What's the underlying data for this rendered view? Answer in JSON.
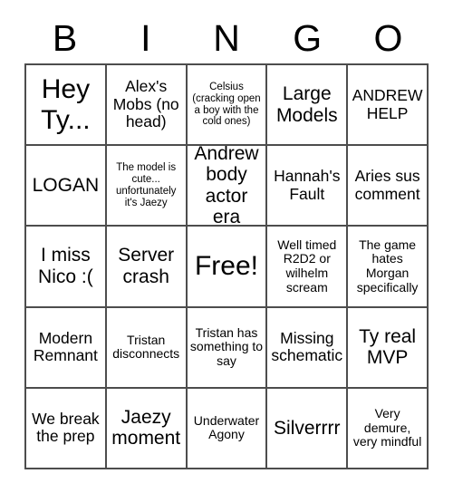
{
  "card": {
    "header_letters": [
      "B",
      "I",
      "N",
      "G",
      "O"
    ],
    "rows": [
      [
        {
          "text": "Hey Ty...",
          "size": "fs-xl"
        },
        {
          "text": "Alex's Mobs (no head)",
          "size": "fs-md"
        },
        {
          "text": "Celsius (cracking open a boy with the cold ones)",
          "size": "fs-xs"
        },
        {
          "text": "Large Models",
          "size": "fs-lg"
        },
        {
          "text": "ANDREW HELP",
          "size": "fs-md"
        }
      ],
      [
        {
          "text": "LOGAN",
          "size": "fs-lg"
        },
        {
          "text": "The model is cute... unfortunately it's Jaezy",
          "size": "fs-xs"
        },
        {
          "text": "Andrew body actor era",
          "size": "fs-lg"
        },
        {
          "text": "Hannah's Fault",
          "size": "fs-md"
        },
        {
          "text": "Aries sus comment",
          "size": "fs-md"
        }
      ],
      [
        {
          "text": "I miss Nico :(",
          "size": "fs-lg"
        },
        {
          "text": "Server crash",
          "size": "fs-lg"
        },
        {
          "text": "Free!",
          "size": "fs-xl"
        },
        {
          "text": "Well timed R2D2 or wilhelm scream",
          "size": "fs-sm"
        },
        {
          "text": "The game hates Morgan specifically",
          "size": "fs-sm"
        }
      ],
      [
        {
          "text": "Modern Remnant",
          "size": "fs-md"
        },
        {
          "text": "Tristan disconnects",
          "size": "fs-sm"
        },
        {
          "text": "Tristan has something to say",
          "size": "fs-sm"
        },
        {
          "text": "Missing schematic",
          "size": "fs-md"
        },
        {
          "text": "Ty real MVP",
          "size": "fs-lg"
        }
      ],
      [
        {
          "text": "We break the prep",
          "size": "fs-md"
        },
        {
          "text": "Jaezy moment",
          "size": "fs-lg"
        },
        {
          "text": "Underwater Agony",
          "size": "fs-sm"
        },
        {
          "text": "Silverrrr",
          "size": "fs-lg"
        },
        {
          "text": "Very demure, very mindful",
          "size": "fs-sm"
        }
      ]
    ]
  },
  "colors": {
    "background": "#ffffff",
    "grid_line": "#4d4d4d",
    "text": "#000000"
  }
}
